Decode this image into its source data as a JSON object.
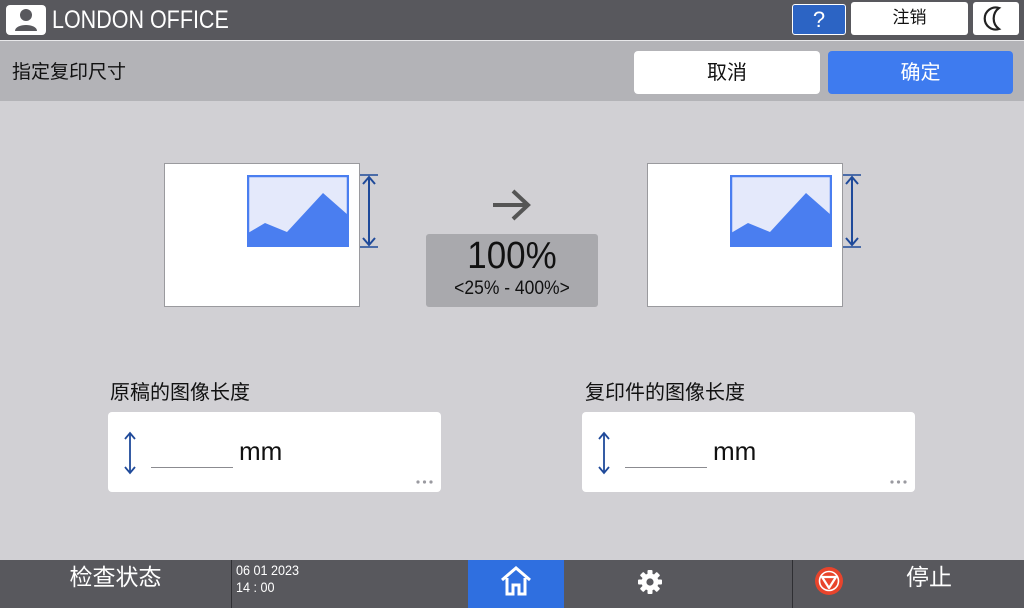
{
  "header": {
    "device_name": "LONDON OFFICE",
    "help_label": "?",
    "logout_label": "注销",
    "user_icon": "user-icon",
    "night_icon": "moon-icon"
  },
  "titlebar": {
    "title": "指定复印尺寸",
    "cancel_label": "取消",
    "ok_label": "确定"
  },
  "ratio": {
    "value": "100%",
    "range": "<25% - 400%>"
  },
  "original_field": {
    "label": "原稿的图像长度",
    "value": "",
    "unit": "mm"
  },
  "copy_field": {
    "label": "复印件的图像长度",
    "value": "",
    "unit": "mm"
  },
  "footer": {
    "check_status_label": "检查状态",
    "date": "06 01 2023",
    "time": "14 : 00",
    "stop_label": "停止"
  },
  "colors": {
    "accent": "#3e7bef",
    "image_blue": "#4a7ef0",
    "dimension_line": "#1f4a9a",
    "stop_red": "#e8442c"
  }
}
